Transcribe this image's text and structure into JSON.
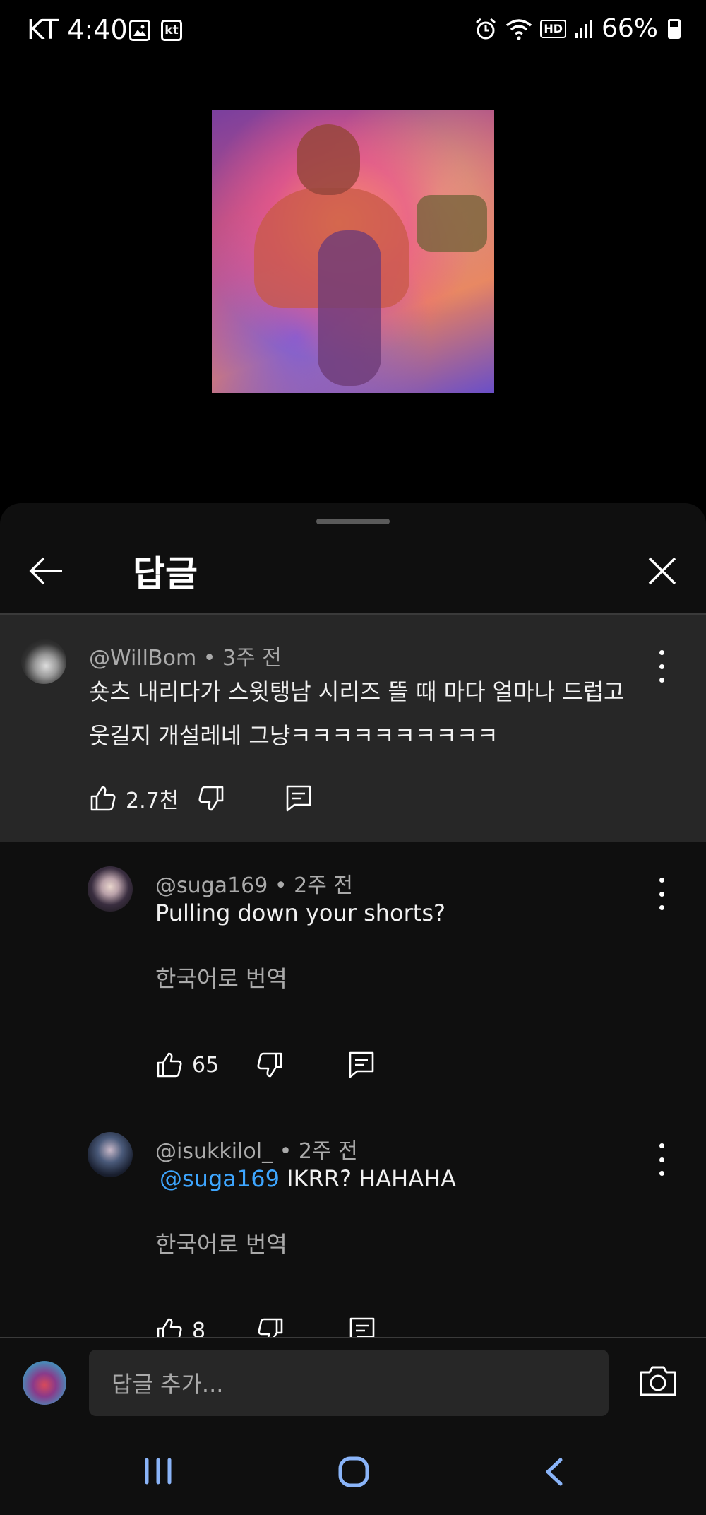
{
  "status_bar": {
    "carrier": "KT",
    "time": "4:40",
    "battery": "66%",
    "network_badge": "HD",
    "kt_badge": "kt"
  },
  "sheet": {
    "title": "답글",
    "back_icon": "arrow-left-icon",
    "close_icon": "close-icon"
  },
  "comments": [
    {
      "author": "@WillBom",
      "age": "3주 전",
      "text_line1": "숏츠 내리다가 스윗탱남 시리즈 뜰 때 마다 얼마나 드럽고",
      "text_line2": "웃길지 개설레네 그냥ㅋㅋㅋㅋㅋㅋㅋㅋㅋㅋ",
      "likes": "2.7천"
    },
    {
      "author": "@suga169",
      "age": "2주 전",
      "text": "Pulling down your shorts?",
      "translate": "한국어로 번역",
      "likes": "65"
    },
    {
      "author": "@isukkilol_",
      "age": "2주 전",
      "mention": "@suga169",
      "text": " IKRR? HAHAHA",
      "translate": "한국어로 번역",
      "likes": "8"
    }
  ],
  "reply_input": {
    "placeholder": "답글 추가..."
  },
  "colors": {
    "accent_link": "#3ea6ff",
    "sheet_bg": "#0f0f0f",
    "highlight_bg": "#272727"
  }
}
